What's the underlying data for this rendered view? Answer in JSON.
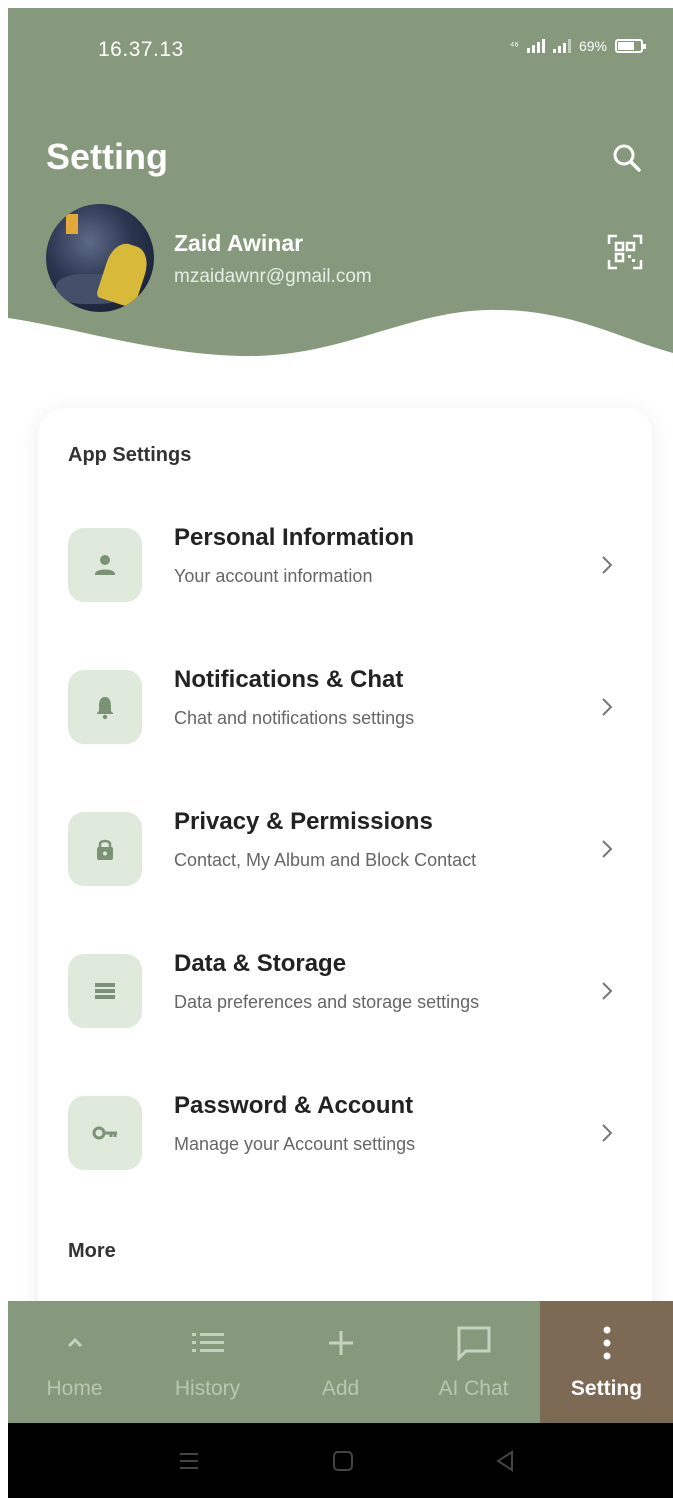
{
  "colors": {
    "header_green": "#87997d",
    "active_nav_brown": "#7d6a55",
    "icon_box_bg": "#dfe9dc",
    "icon_color": "#7c9276"
  },
  "status_bar": {
    "time": "16.37.13",
    "network": "⁴⁶",
    "battery": "69%"
  },
  "header": {
    "title": "Setting",
    "search_icon": "search-icon",
    "qr_icon": "qr-code-icon"
  },
  "profile": {
    "name": "Zaid Awinar",
    "email": "mzaidawnr@gmail.com"
  },
  "app_settings": {
    "section_title": "App Settings",
    "items": [
      {
        "icon": "person-icon",
        "title": "Personal Information",
        "subtitle": "Your account information"
      },
      {
        "icon": "bell-icon",
        "title": "Notifications & Chat",
        "subtitle": "Chat and notifications settings"
      },
      {
        "icon": "lock-icon",
        "title": "Privacy & Permissions",
        "subtitle": "Contact, My Album and Block Contact"
      },
      {
        "icon": "storage-icon",
        "title": "Data & Storage",
        "subtitle": "Data preferences and storage settings"
      },
      {
        "icon": "key-icon",
        "title": "Password & Account",
        "subtitle": "Manage your Account settings"
      }
    ]
  },
  "more": {
    "section_title": "More"
  },
  "bottom_nav": {
    "items": [
      {
        "icon": "chevron-up-icon",
        "label": "Home"
      },
      {
        "icon": "list-icon",
        "label": "History"
      },
      {
        "icon": "plus-icon",
        "label": "Add"
      },
      {
        "icon": "chat-icon",
        "label": "AI Chat"
      },
      {
        "icon": "more-vertical-icon",
        "label": "Setting"
      }
    ],
    "active": "Setting"
  },
  "system_nav": {
    "buttons": [
      "menu",
      "home",
      "back"
    ]
  }
}
